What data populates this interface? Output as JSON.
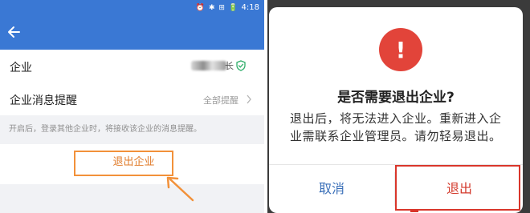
{
  "left_screen": {
    "status_bar": {
      "icons": "⏰ ✱ ⊞ 🔋",
      "time": "4:18"
    },
    "toolbar": {
      "back_icon": "arrow-left-icon"
    },
    "enterprise_row": {
      "label": "企业",
      "value_partial": "长",
      "verified_icon": "shield-check-icon"
    },
    "notice_row": {
      "label": "企业消息提醒",
      "value": "全部提醒"
    },
    "hint": "开启后，登录其他企业时，将接收该企业的消息提醒。",
    "exit_button": "退出企业",
    "annotation_color": "#f2913a"
  },
  "dialog": {
    "icon": "exclamation-icon",
    "icon_symbol": "!",
    "title": "是否需要退出企业?",
    "body": "退出后，将无法进入企业。重新进入企业需联系企业管理员。请勿轻易退出。",
    "cancel": "取消",
    "confirm": "退出",
    "accent": "#e2443a"
  }
}
